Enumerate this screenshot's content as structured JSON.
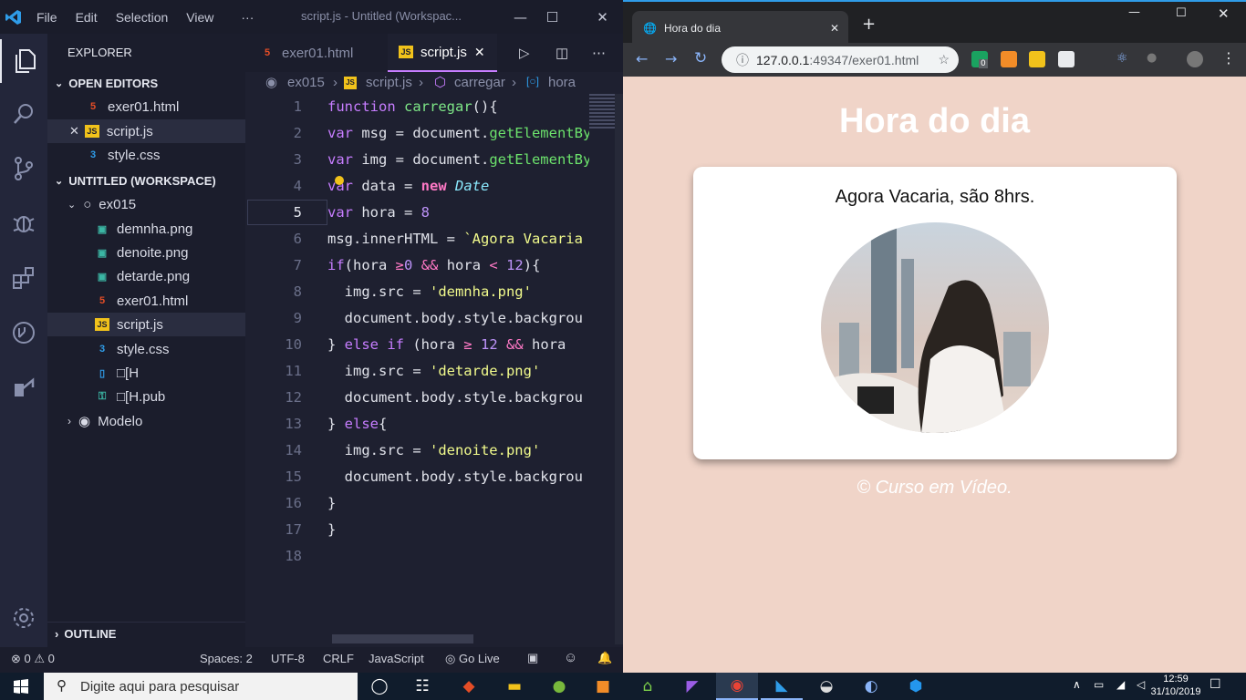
{
  "vscode": {
    "menu": [
      "File",
      "Edit",
      "Selection",
      "View",
      "···"
    ],
    "window_title": "script.js - Untitled (Workspac...",
    "explorer_title": "EXPLORER",
    "open_editors_title": "OPEN EDITORS",
    "open_editors": [
      "exer01.html",
      "script.js",
      "style.css"
    ],
    "workspace_title": "UNTITLED (WORKSPACE)",
    "folder": "ex015",
    "files": [
      "demnha.png",
      "denoite.png",
      "detarde.png",
      "exer01.html",
      "script.js",
      "style.css",
      "□[H",
      "□[H.pub"
    ],
    "folder2": "Modelo",
    "outline_title": "OUTLINE",
    "tabs": [
      "exer01.html",
      "script.js"
    ],
    "breadcrumb": [
      "ex015",
      "script.js",
      "carregar",
      "hora"
    ],
    "line_numbers": [
      "1",
      "2",
      "3",
      "4",
      "5",
      "6",
      "7",
      "8",
      "9",
      "10",
      "11",
      "12",
      "13",
      "14",
      "15",
      "16",
      "17",
      "18"
    ],
    "status": {
      "errors": "0",
      "warnings": "0",
      "spaces": "Spaces: 2",
      "encoding": "UTF-8",
      "eol": "CRLF",
      "language": "JavaScript",
      "golive": "Go Live"
    }
  },
  "chrome": {
    "tab_title": "Hora do dia",
    "url_host": "127.0.0.1",
    "url_rest": ":49347/exer01.html",
    "ext_badge": "0"
  },
  "page": {
    "heading": "Hora do dia",
    "message": "Agora Vacaria, são 8hrs.",
    "footer": "© Curso em Vídeo."
  },
  "taskbar": {
    "search_placeholder": "Digite aqui para pesquisar",
    "time": "12:59",
    "date": "31/10/2019"
  },
  "colors": {
    "page_bg": "#f0d4c8",
    "vscode_accent": "#2f9ce8"
  }
}
